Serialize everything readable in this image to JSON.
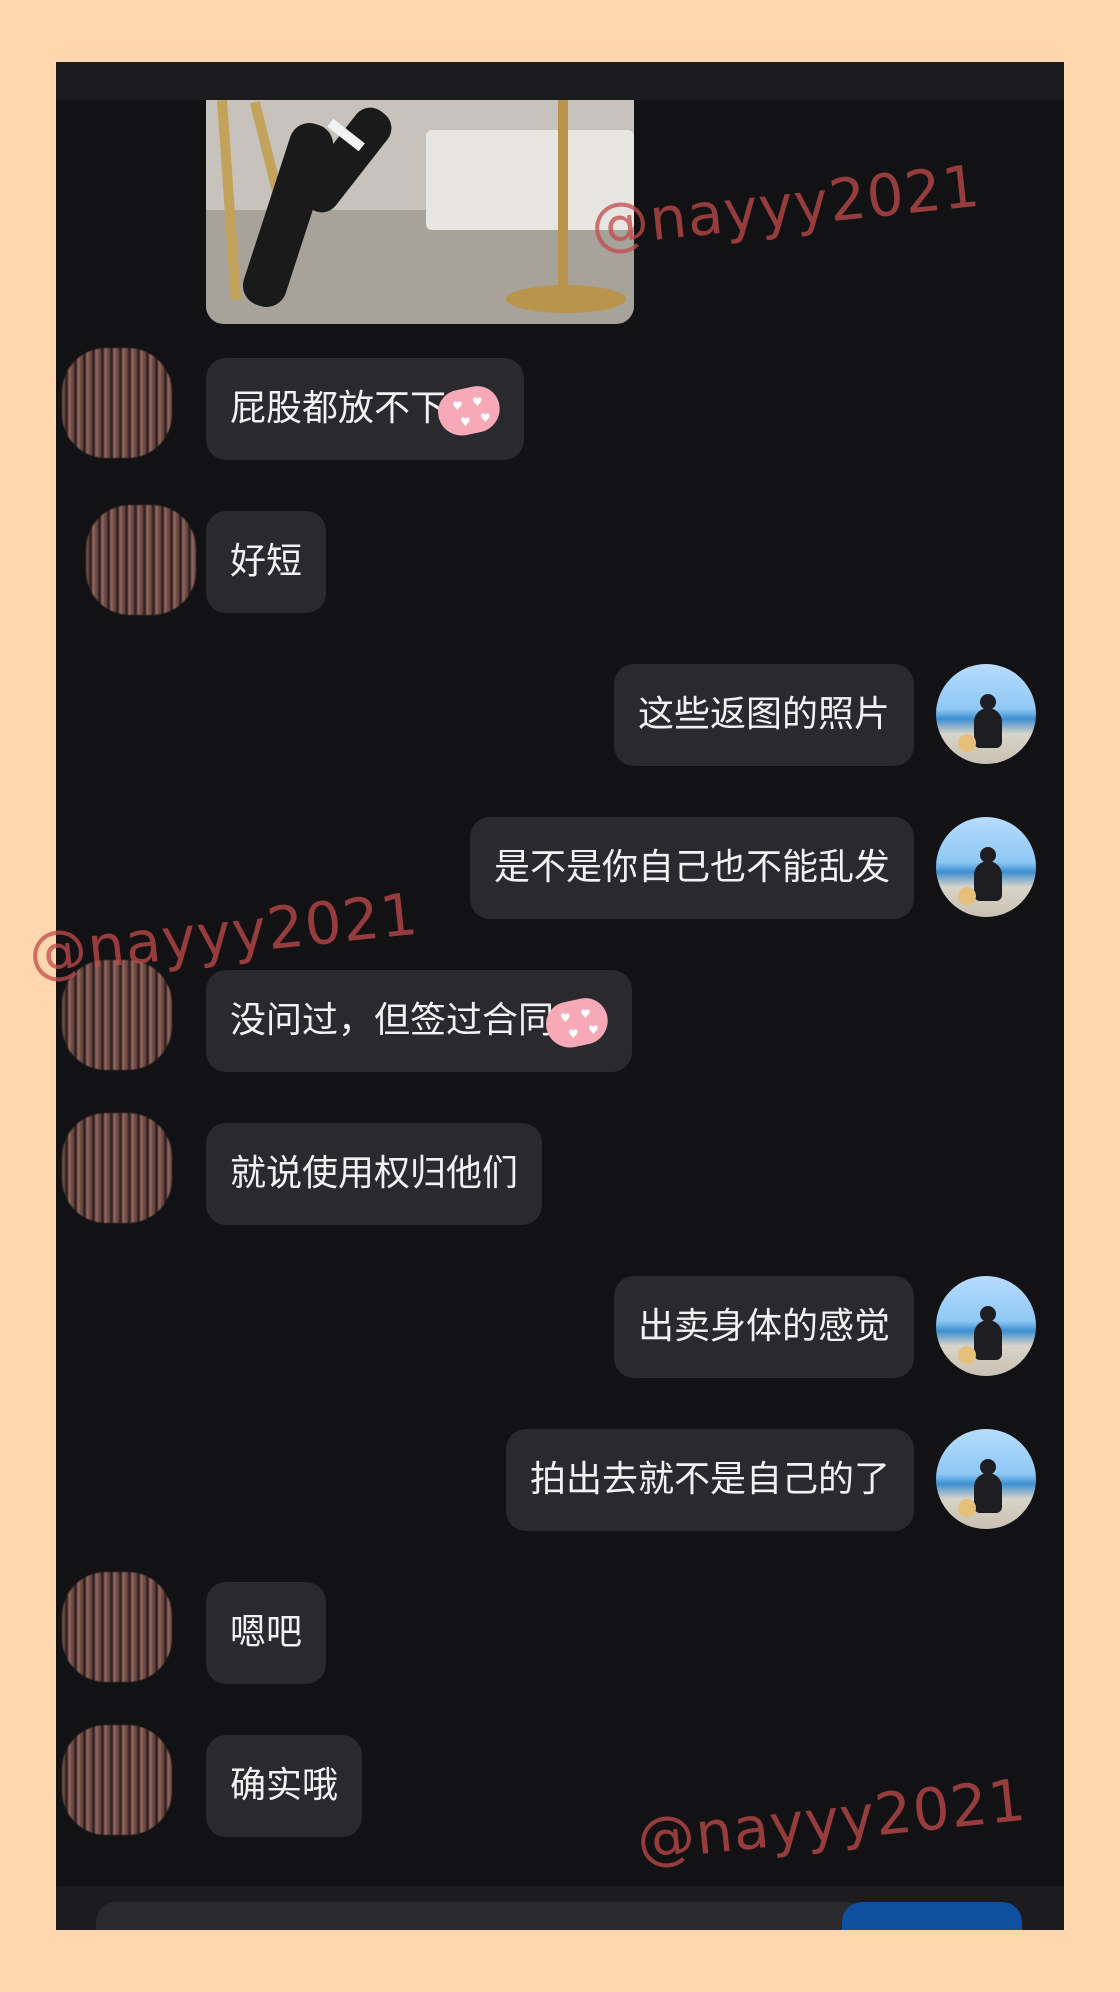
{
  "messages": [
    {
      "side": "left",
      "text": "屁股都放不下",
      "sticker": "heart-sticker"
    },
    {
      "side": "left",
      "text": "好短"
    },
    {
      "side": "right",
      "text": "这些返图的照片"
    },
    {
      "side": "right",
      "text": "是不是你自己也不能乱发"
    },
    {
      "side": "left",
      "text": "没问过，但签过合同",
      "sticker": "heart-sticker"
    },
    {
      "side": "left",
      "text": "就说使用权归他们"
    },
    {
      "side": "right",
      "text": "出卖身体的感觉"
    },
    {
      "side": "right",
      "text": "拍出去就不是自己的了"
    },
    {
      "side": "left",
      "text": "嗯吧"
    },
    {
      "side": "left",
      "text": "确实哦"
    }
  ],
  "watermark": "@nayyy2021",
  "colors": {
    "page_background": "#FFD6AE",
    "chat_background": "#121214",
    "bubble": "#2a2a2e",
    "bubble_text": "#f2f2f2",
    "send_button": "#0f4fa0",
    "watermark": "#c24b4b"
  }
}
